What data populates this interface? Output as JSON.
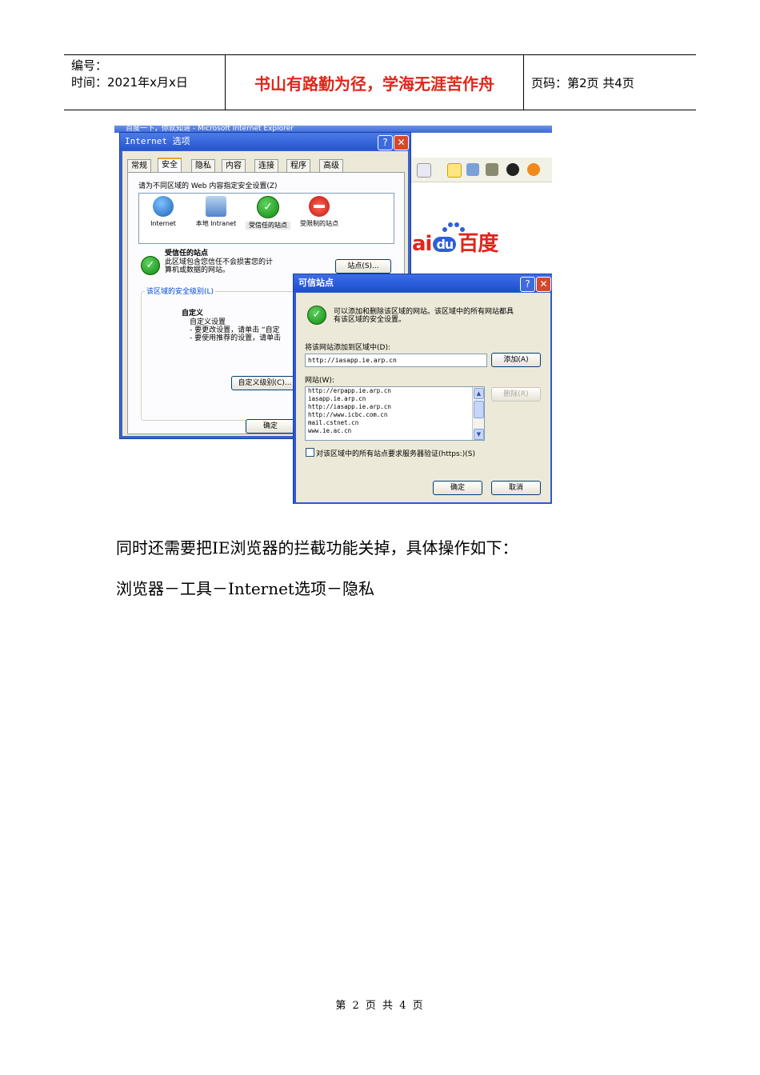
{
  "header": {
    "number_label": "编号：",
    "time_label": "时间：2021年x月x日",
    "motto": "书山有路勤为径，学海无涯苦作舟",
    "page_label": "页码：第2页  共4页"
  },
  "screenshot": {
    "ie_window_title": "百度一下，你就知道 - Microsoft Internet Explorer",
    "baidu_logo": {
      "left": "ai",
      "mid": "du",
      "right": "百度"
    },
    "internet_options": {
      "title": "Internet 选项",
      "help": "?",
      "close": "✕",
      "tabs": [
        "常规",
        "安全",
        "隐私",
        "内容",
        "连接",
        "程序",
        "高级"
      ],
      "active_tab": "安全",
      "zone_prompt": "请为不同区域的 Web 内容指定安全设置(Z)",
      "zones": [
        {
          "label": "Internet",
          "icon": "globe-icon"
        },
        {
          "label": "本地 Intranet",
          "icon": "computer-icon"
        },
        {
          "label": "受信任的站点",
          "icon": "trusted-check-icon"
        },
        {
          "label": "受限制的站点",
          "icon": "restricted-icon"
        }
      ],
      "zone_heading": "受信任的站点",
      "zone_desc_1": "此区域包含您信任不会损害您的计",
      "zone_desc_2": "算机或数据的网站。",
      "sites_button": "站点(S)...",
      "security_group": "该区域的安全级别(L)",
      "level_title": "自定义",
      "level_line1": "自定义设置",
      "level_line2": "- 要更改设置，请单击 “自定",
      "level_line3": "- 要使用推荐的设置，请单击",
      "custom_level_button": "自定义级别(C)...",
      "ok_button": "确定"
    },
    "trusted_sites": {
      "title": "可信站点",
      "help": "?",
      "close": "✕",
      "info_1": "可以添加和删除该区域的网站。该区域中的所有网站都具",
      "info_2": "有该区域的安全设置。",
      "add_label": "将该网站添加到区域中(D):",
      "add_value": "http://iasapp.ie.arp.cn",
      "add_button": "添加(A)",
      "sites_label": "网站(W):",
      "sites": [
        "http://erpapp.ie.arp.cn",
        "iasapp.ie.arp.cn",
        "http://iasapp.ie.arp.cn",
        "http://www.icbc.com.cn",
        "mail.cstnet.cn",
        "www.ie.ac.cn"
      ],
      "remove_button": "删除(R)",
      "https_checkbox": "对该区域中的所有站点要求服务器验证(https:)(S)",
      "ok_button": "确定",
      "cancel_button": "取消"
    }
  },
  "body": {
    "para1": "同时还需要把IE浏览器的拦截功能关掉，具体操作如下：",
    "para2": "浏览器－工具－Internet选项－隐私"
  },
  "footer": {
    "page": "第 2 页 共 4 页"
  }
}
